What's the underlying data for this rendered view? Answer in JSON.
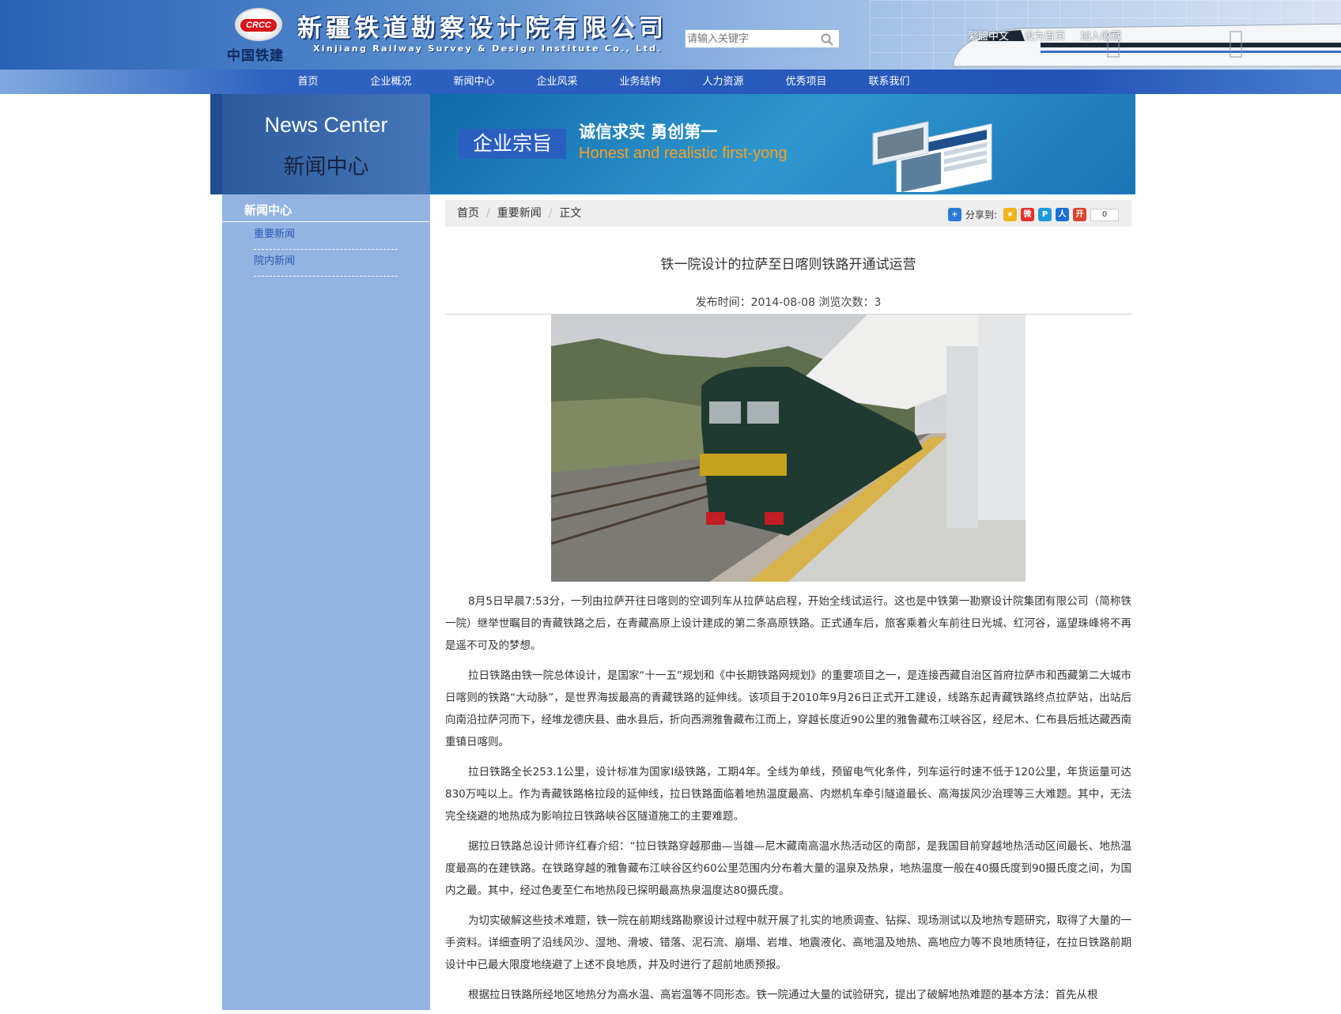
{
  "header": {
    "logo_text": "中国铁建",
    "logo_badge": "CRCC",
    "company_name_cn": "新疆铁道勘察设计院有限公司",
    "company_name_en": "Xinjiang Railway Survey & Design Institute Co., Ltd.",
    "search_placeholder": "请输入关键字",
    "top_links": [
      "繁體中文",
      "设为首页",
      "加入收藏"
    ]
  },
  "nav": {
    "items": [
      "首页",
      "企业概况",
      "新闻中心",
      "企业风采",
      "业务结构",
      "人力资源",
      "优秀项目",
      "联系我们"
    ]
  },
  "banner": {
    "title_en": "News Center",
    "title_cn": "新闻中心",
    "motto_badge": "企业宗旨",
    "motto_cn": "诚信求实 勇创第一",
    "motto_en": "Honest and realistic first-yong"
  },
  "sidebar": {
    "title": "新闻中心",
    "items": [
      "重要新闻",
      "院内新闻"
    ]
  },
  "breadcrumb": {
    "items": [
      "首页",
      "重要新闻",
      "正文"
    ]
  },
  "share": {
    "label": "分享到:",
    "count": "0",
    "colors": {
      "plus": "#2a7ad5",
      "qzone": "#f2b31b",
      "weibo": "#e5322d",
      "tqq": "#1f9bde",
      "renren": "#1d6fd2",
      "kaixin": "#d9432f"
    }
  },
  "article": {
    "title": "铁一院设计的拉萨至日喀则铁路开通试运营",
    "meta": "发布时间：2014-08-08 浏览次数：3",
    "paragraphs": [
      "8月5日早晨7:53分，一列由拉萨开往日喀则的空调列车从拉萨站启程，开始全线试运行。这也是中铁第一勘察设计院集团有限公司（简称铁一院）继举世瞩目的青藏铁路之后，在青藏高原上设计建成的第二条高原铁路。正式通车后，旅客乘着火车前往日光城、红河谷，遥望珠峰将不再是遥不可及的梦想。",
      "拉日铁路由铁一院总体设计，是国家“十一五”规划和《中长期铁路网规划》的重要项目之一，是连接西藏自治区首府拉萨市和西藏第二大城市日喀则的铁路“大动脉”，是世界海拔最高的青藏铁路的延伸线。该项目于2010年9月26日正式开工建设，线路东起青藏铁路终点拉萨站，出站后向南沿拉萨河而下，经堆龙德庆县、曲水县后，折向西溯雅鲁藏布江而上，穿越长度近90公里的雅鲁藏布江峡谷区，经尼木、仁布县后抵达藏西南重镇日喀则。",
      "拉日铁路全长253.1公里，设计标准为国家Ⅰ级铁路，工期4年。全线为单线，预留电气化条件，列车运行时速不低于120公里，年货运量可达830万吨以上。作为青藏铁路格拉段的延伸线，拉日铁路面临着地热温度最高、内燃机车牵引隧道最长、高海拔风沙治理等三大难题。其中，无法完全绕避的地热成为影响拉日铁路峡谷区隧道施工的主要难题。",
      "据拉日铁路总设计师许红春介绍：“拉日铁路穿越那曲—当雄—尼木藏南高温水热活动区的南部，是我国目前穿越地热活动区间最长、地热温度最高的在建铁路。在铁路穿越的雅鲁藏布江峡谷区约60公里范围内分布着大量的温泉及热泉，地热温度一般在40摄氏度到90摄氏度之间，为国内之最。其中，经过色麦至仁布地热段已探明最高热泉温度达80摄氏度。",
      "为切实破解这些技术难题，铁一院在前期线路勘察设计过程中就开展了扎实的地质调查、钻探、现场测试以及地热专题研究，取得了大量的一手资料。详细查明了沿线风沙、湿地、滑坡、错落、泥石流、崩塌、岩堆、地震液化、高地温及地热、高地应力等不良地质特征，在拉日铁路前期设计中已最大限度地绕避了上述不良地质，并及时进行了超前地质预报。",
      "根据拉日铁路所经地区地热分为高水温、高岩温等不同形态。铁一院通过大量的试验研究，提出了破解地热难题的基本方法：首先从根"
    ]
  }
}
